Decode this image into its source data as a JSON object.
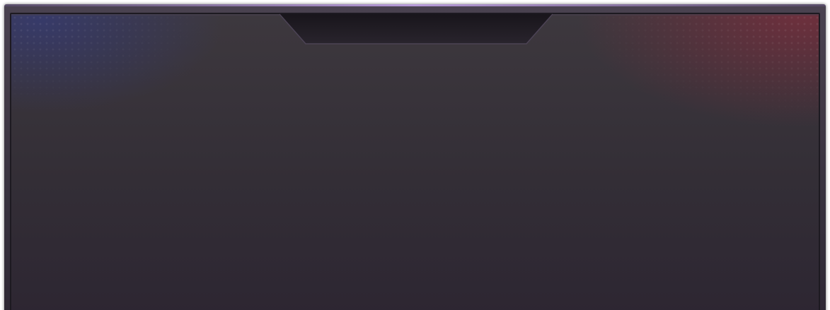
{
  "window": {
    "title": "",
    "content": []
  },
  "colors": {
    "frame": "#3f3845",
    "panel_top": "#3d383e",
    "panel_bottom": "#2d2632",
    "accent_top": "#b79ad9",
    "glow_left": "#323c8c",
    "glow_right": "#96283c"
  }
}
